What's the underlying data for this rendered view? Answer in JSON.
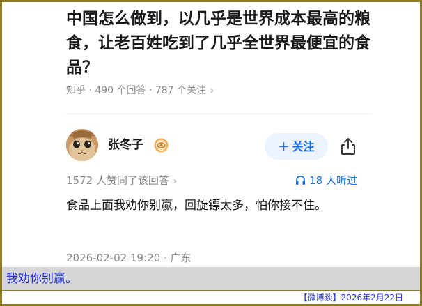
{
  "question": {
    "title": "中国怎么做到，以几乎是世界成本最高的粮食，让老百姓吃到了几乎全世界最便宜的食品？",
    "meta": "知乎 · 490 个回答 · 787 个关注",
    "meta_chevron": "›"
  },
  "author": {
    "name": "张冬子",
    "follow_label": "关注",
    "follow_plus": "+"
  },
  "answer": {
    "agree_text": "1572 人赞同了该回答",
    "agree_chevron": "›",
    "listen_text": "18 人听过",
    "body": "食品上面我劝你别赢，回旋镖太多，怕你接不住。",
    "time_location": "2026-02-02 19:20 · 广东"
  },
  "caption": "我劝你别赢。",
  "footer": "【微博谈】2026年2月22日",
  "colors": {
    "accent": "#1772f6",
    "follow_bg": "#ebf3ff",
    "caption_text": "#1e2fd6",
    "frame": "#8b7a22"
  },
  "icons": {
    "avatar": "cat-avatar",
    "badge": "eye-badge-icon",
    "share": "share-icon",
    "listen": "headphones-icon"
  }
}
